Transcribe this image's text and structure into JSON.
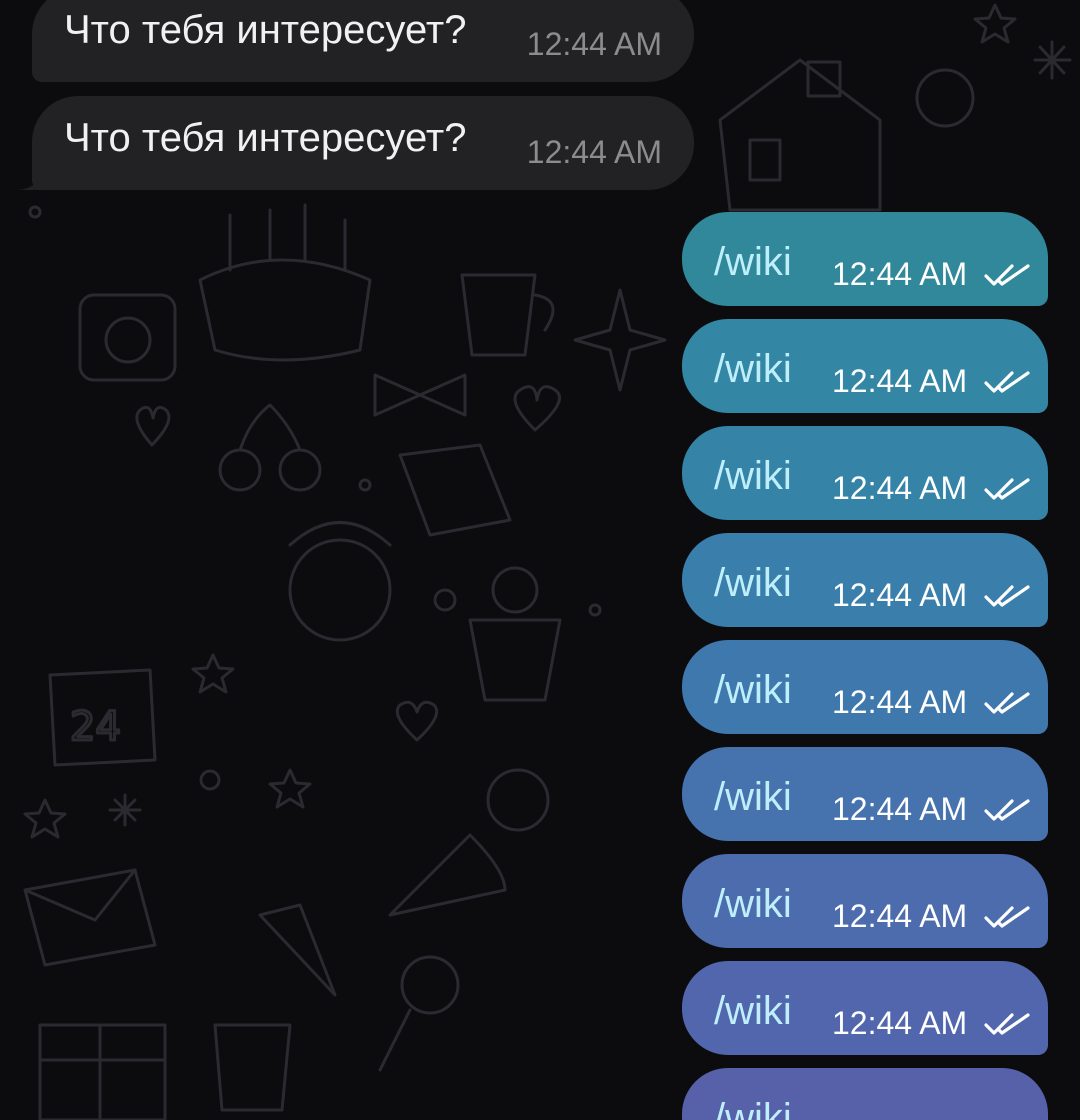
{
  "incoming_messages": [
    {
      "text": "Что тебя интересует?",
      "time": "12:44 AM"
    },
    {
      "text": "Что тебя интересует?",
      "time": "12:44 AM"
    }
  ],
  "outgoing_messages": [
    {
      "text": "/wiki",
      "time": "12:44 AM",
      "status": "read-double-check-icon",
      "color": "#31889a"
    },
    {
      "text": "/wiki",
      "time": "12:44 AM",
      "status": "read-double-check-icon",
      "color": "#3387a4"
    },
    {
      "text": "/wiki",
      "time": "12:44 AM",
      "status": "read-double-check-icon",
      "color": "#3584a7"
    },
    {
      "text": "/wiki",
      "time": "12:44 AM",
      "status": "read-double-check-icon",
      "color": "#3a7fab"
    },
    {
      "text": "/wiki",
      "time": "12:44 AM",
      "status": "read-double-check-icon",
      "color": "#3f78ad"
    },
    {
      "text": "/wiki",
      "time": "12:44 AM",
      "status": "read-double-check-icon",
      "color": "#4673ae"
    },
    {
      "text": "/wiki",
      "time": "12:44 AM",
      "status": "read-double-check-icon",
      "color": "#4c6cae"
    },
    {
      "text": "/wiki",
      "time": "12:44 AM",
      "status": "read-double-check-icon",
      "color": "#5166ad"
    },
    {
      "text": "/wiki",
      "time": "",
      "status": "",
      "color": "#5761aa"
    }
  ],
  "colors": {
    "incoming_bubble": "#222224",
    "background": "#0c0c0e"
  }
}
